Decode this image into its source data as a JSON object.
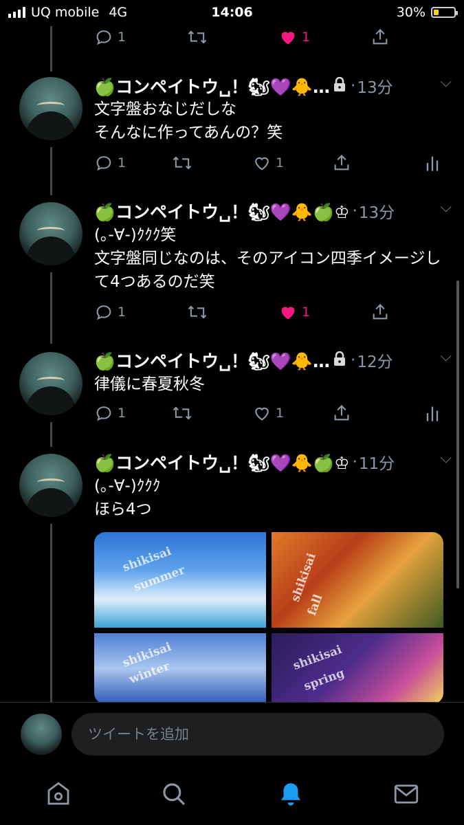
{
  "status_bar": {
    "carrier": "UQ mobile",
    "network": "4G",
    "time": "14:06",
    "battery": "30%",
    "battery_level": 0.3
  },
  "top_actions": {
    "reply_count": "1",
    "like_count": "1"
  },
  "tweets": [
    {
      "name": "🍏コンペイトウ␣！🐿💜🐥…",
      "badge": "lock",
      "time": "13分",
      "text": "文字盤おなじだしな\nそんなに作ってあんの？笑",
      "reply_count": "1",
      "like_count": "1",
      "liked": false
    },
    {
      "name": "🍏コンペイトウ␣！🐿💜🐥🍏♔",
      "badge": "",
      "time": "13分",
      "text": "(｡-∀-)ｸｸｸ笑\n文字盤同じなのは、そのアイコン四季イメージして4つあるのだ笑",
      "reply_count": "1",
      "like_count": "1",
      "liked": true
    },
    {
      "name": "🍏コンペイトウ␣！🐿💜🐥…",
      "badge": "lock",
      "time": "12分",
      "text": "律儀に春夏秋冬",
      "reply_count": "1",
      "like_count": "1",
      "liked": false
    },
    {
      "name": "🍏コンペイトウ␣！🐿💜🐥🍏♔",
      "badge": "",
      "time": "11分",
      "text": "(｡-∀-)ｸｸｸ\nほら4つ",
      "reply_count": "",
      "like_count": "",
      "liked": false
    }
  ],
  "media": {
    "summer": {
      "line1": "shikisai",
      "line2": "summer"
    },
    "fall": {
      "line1": "shikisai",
      "line2": "fall"
    },
    "winter": {
      "line1": "shikisai",
      "line2": "winter"
    },
    "spring": {
      "line1": "shikisai",
      "line2": "spring"
    }
  },
  "compose": {
    "placeholder": "ツイートを追加"
  },
  "tabs": [
    "home-icon",
    "search-icon",
    "notifications-icon",
    "messages-icon"
  ],
  "colors": {
    "like": "#f91880",
    "accent": "#1d9bf0",
    "muted": "#8b98a5"
  }
}
